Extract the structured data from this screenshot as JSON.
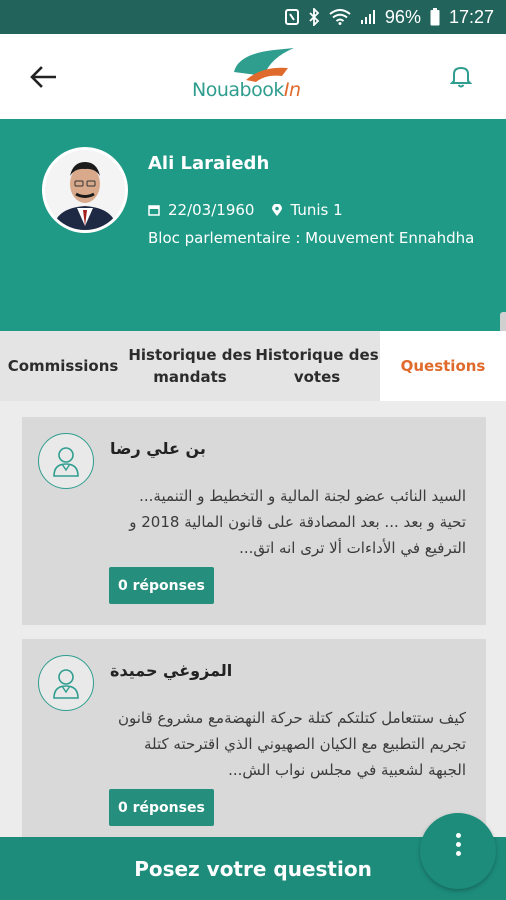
{
  "status_bar": {
    "battery": "96%",
    "time": "17:27"
  },
  "app_bar": {
    "logo_main": "Nouabook",
    "logo_suffix": "In"
  },
  "profile": {
    "name": "Ali Laraiedh",
    "birthdate": "22/03/1960",
    "location": "Tunis 1",
    "bloc": "Bloc parlementaire : Mouvement Ennahdha"
  },
  "tabs": [
    {
      "label": "Commissions"
    },
    {
      "label": "Historique des mandats"
    },
    {
      "label": "Historique des votes"
    },
    {
      "label": "Questions"
    }
  ],
  "questions": [
    {
      "author": "بن علي رضا",
      "text": "السيد النائب عضو لجنة المالية و التخطيط و التنمية... تحية و بعد ... بعد المصادقة على قانون المالية 2018 و الترفيع في الأداءات ألا ترى انه اتق...",
      "responses": "0 réponses"
    },
    {
      "author": "المزوغي حميدة",
      "text": "كيف ستتعامل كتلتكم كتلة حركة النهضةمع مشروع قانون تجريم التطبيع مع الكيان الصهيوني الذي اقترحته كتلة الجبهة لشعبية في مجلس نواب الش...",
      "responses": "0 réponses"
    }
  ],
  "bottom_bar": {
    "label": "Posez votre question"
  },
  "colors": {
    "teal": "#1f9a86",
    "accent": "#e06a2c",
    "dark_teal": "#22645b"
  }
}
